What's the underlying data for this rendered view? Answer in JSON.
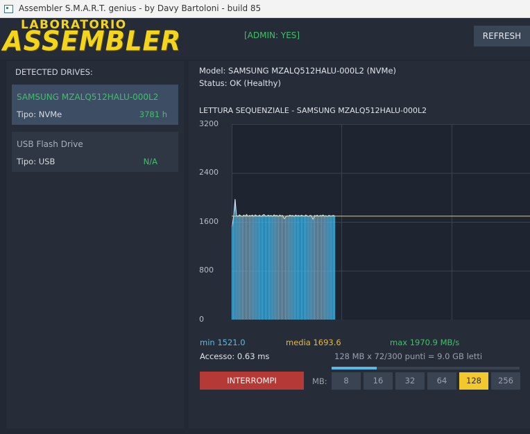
{
  "window": {
    "title": "Assembler S.M.A.R.T. genius - by Davy Bartoloni - build 85"
  },
  "header": {
    "logo_top": "LABORATORIO",
    "logo_main": "ASSEMBLER",
    "admin_status": "[ADMIN: YES]",
    "refresh_label": "REFRESH"
  },
  "sidebar": {
    "title": "DETECTED DRIVES:",
    "drives": [
      {
        "name": "SAMSUNG MZALQ512HALU-000L2",
        "tipo": "Tipo: NVMe",
        "hours": "3781 h",
        "selected": true
      },
      {
        "name": "USB Flash Drive",
        "tipo": "Tipo: USB",
        "hours": "N/A",
        "selected": false
      }
    ]
  },
  "main": {
    "model": "Model: SAMSUNG MZALQ512HALU-000L2 (NVMe)",
    "status": "Status: OK (Healthy)",
    "stats": {
      "min": "min 1521.0",
      "avg": "media 1693.6",
      "max": "max 1970.9 MB/s",
      "access": "Accesso: 0.63 ms",
      "progress_text": "128 MB x 72/300 punti = 9.0 GB letti",
      "progress_fraction": 0.24
    },
    "stop_label": "INTERROMPI",
    "mb_label": "MB:",
    "mb_options": [
      "8",
      "16",
      "32",
      "64",
      "128",
      "256"
    ],
    "mb_selected": "128"
  },
  "colors": {
    "bar": "#5bb9e6",
    "line": "#d7e8f5",
    "avg_line": "#e8d040",
    "grid": "#3a4250",
    "accent_green": "#3fc06a",
    "accent_yellow": "#f2c82c",
    "stop_red": "#b53a35"
  },
  "chart_data": {
    "type": "bar",
    "title": "LETTURA SEQUENZIALE - SAMSUNG MZALQ512HALU-000L2",
    "ylim": [
      0,
      3200
    ],
    "yticks": [
      "3200",
      "2400",
      "1600",
      "800",
      "0"
    ],
    "total_points": 300,
    "average": 1693.6,
    "series": [
      {
        "values": [
          1521,
          1700,
          1970,
          1705,
          1690,
          1715,
          1700,
          1688,
          1710,
          1695,
          1720,
          1690,
          1705,
          1698,
          1712,
          1690,
          1715,
          1700,
          1695,
          1710,
          1688,
          1705,
          1720,
          1700,
          1695,
          1710,
          1698,
          1705,
          1690,
          1715,
          1700,
          1708,
          1690,
          1712,
          1698,
          1705,
          1650,
          1680,
          1700,
          1695,
          1710,
          1700,
          1705,
          1690,
          1712,
          1698,
          1706,
          1694,
          1710,
          1700,
          1695,
          1712,
          1700,
          1690,
          1708,
          1700,
          1640,
          1705,
          1698,
          1710,
          1690,
          1705,
          1700,
          1712,
          1695,
          1702,
          1690,
          1708,
          1700,
          1698,
          1705,
          1700
        ]
      }
    ]
  }
}
